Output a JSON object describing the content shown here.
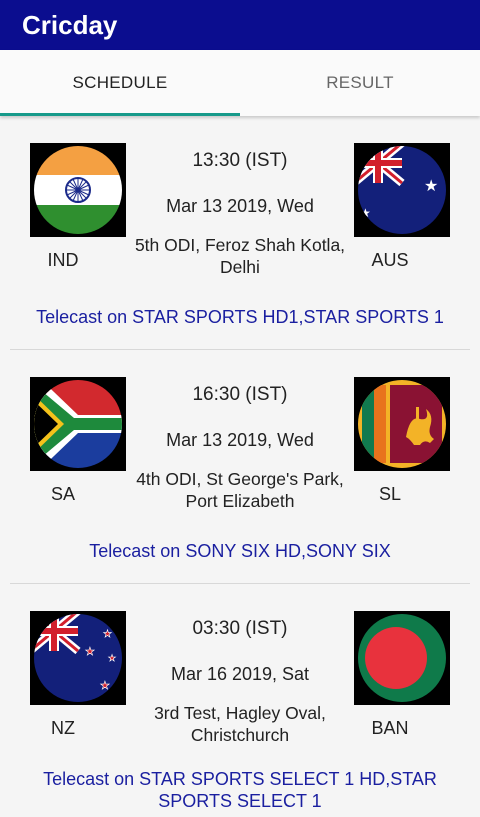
{
  "app": {
    "title": "Cricday"
  },
  "tabs": [
    {
      "label": "SCHEDULE",
      "active": true
    },
    {
      "label": "RESULT",
      "active": false
    }
  ],
  "colors": {
    "appbar": "#0b0d8f",
    "tab_indicator": "#169a8a",
    "telecast_text": "#1a1fa0"
  },
  "matches": [
    {
      "team1": "IND",
      "team1_flag": "india-flag-icon",
      "team2": "AUS",
      "team2_flag": "australia-flag-icon",
      "time": "13:30 (IST)",
      "date": "Mar 13 2019, Wed",
      "venue": "5th ODI, Feroz Shah Kotla, Delhi",
      "telecast": "Telecast on STAR SPORTS HD1,STAR SPORTS 1"
    },
    {
      "team1": "SA",
      "team1_flag": "south-africa-flag-icon",
      "team2": "SL",
      "team2_flag": "sri-lanka-flag-icon",
      "time": "16:30 (IST)",
      "date": "Mar 13 2019, Wed",
      "venue": "4th ODI, St George's Park, Port Elizabeth",
      "telecast": "Telecast on SONY SIX HD,SONY SIX"
    },
    {
      "team1": "NZ",
      "team1_flag": "new-zealand-flag-icon",
      "team2": "BAN",
      "team2_flag": "bangladesh-flag-icon",
      "time": "03:30 (IST)",
      "date": "Mar 16 2019, Sat",
      "venue": "3rd Test, Hagley Oval, Christchurch",
      "telecast": "Telecast on STAR SPORTS SELECT 1 HD,STAR SPORTS SELECT 1"
    }
  ]
}
